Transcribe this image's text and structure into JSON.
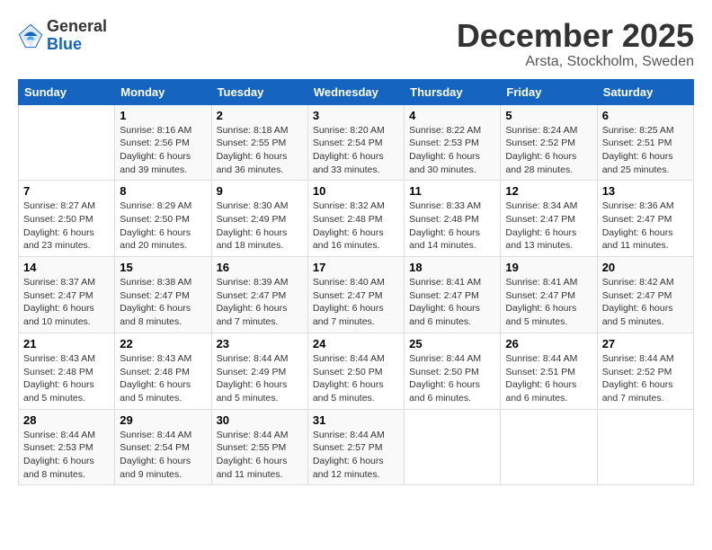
{
  "logo": {
    "general": "General",
    "blue": "Blue"
  },
  "title": "December 2025",
  "subtitle": "Arsta, Stockholm, Sweden",
  "days_header": [
    "Sunday",
    "Monday",
    "Tuesday",
    "Wednesday",
    "Thursday",
    "Friday",
    "Saturday"
  ],
  "weeks": [
    [
      {
        "num": "",
        "info": ""
      },
      {
        "num": "1",
        "info": "Sunrise: 8:16 AM\nSunset: 2:56 PM\nDaylight: 6 hours\nand 39 minutes."
      },
      {
        "num": "2",
        "info": "Sunrise: 8:18 AM\nSunset: 2:55 PM\nDaylight: 6 hours\nand 36 minutes."
      },
      {
        "num": "3",
        "info": "Sunrise: 8:20 AM\nSunset: 2:54 PM\nDaylight: 6 hours\nand 33 minutes."
      },
      {
        "num": "4",
        "info": "Sunrise: 8:22 AM\nSunset: 2:53 PM\nDaylight: 6 hours\nand 30 minutes."
      },
      {
        "num": "5",
        "info": "Sunrise: 8:24 AM\nSunset: 2:52 PM\nDaylight: 6 hours\nand 28 minutes."
      },
      {
        "num": "6",
        "info": "Sunrise: 8:25 AM\nSunset: 2:51 PM\nDaylight: 6 hours\nand 25 minutes."
      }
    ],
    [
      {
        "num": "7",
        "info": "Sunrise: 8:27 AM\nSunset: 2:50 PM\nDaylight: 6 hours\nand 23 minutes."
      },
      {
        "num": "8",
        "info": "Sunrise: 8:29 AM\nSunset: 2:50 PM\nDaylight: 6 hours\nand 20 minutes."
      },
      {
        "num": "9",
        "info": "Sunrise: 8:30 AM\nSunset: 2:49 PM\nDaylight: 6 hours\nand 18 minutes."
      },
      {
        "num": "10",
        "info": "Sunrise: 8:32 AM\nSunset: 2:48 PM\nDaylight: 6 hours\nand 16 minutes."
      },
      {
        "num": "11",
        "info": "Sunrise: 8:33 AM\nSunset: 2:48 PM\nDaylight: 6 hours\nand 14 minutes."
      },
      {
        "num": "12",
        "info": "Sunrise: 8:34 AM\nSunset: 2:47 PM\nDaylight: 6 hours\nand 13 minutes."
      },
      {
        "num": "13",
        "info": "Sunrise: 8:36 AM\nSunset: 2:47 PM\nDaylight: 6 hours\nand 11 minutes."
      }
    ],
    [
      {
        "num": "14",
        "info": "Sunrise: 8:37 AM\nSunset: 2:47 PM\nDaylight: 6 hours\nand 10 minutes."
      },
      {
        "num": "15",
        "info": "Sunrise: 8:38 AM\nSunset: 2:47 PM\nDaylight: 6 hours\nand 8 minutes."
      },
      {
        "num": "16",
        "info": "Sunrise: 8:39 AM\nSunset: 2:47 PM\nDaylight: 6 hours\nand 7 minutes."
      },
      {
        "num": "17",
        "info": "Sunrise: 8:40 AM\nSunset: 2:47 PM\nDaylight: 6 hours\nand 7 minutes."
      },
      {
        "num": "18",
        "info": "Sunrise: 8:41 AM\nSunset: 2:47 PM\nDaylight: 6 hours\nand 6 minutes."
      },
      {
        "num": "19",
        "info": "Sunrise: 8:41 AM\nSunset: 2:47 PM\nDaylight: 6 hours\nand 5 minutes."
      },
      {
        "num": "20",
        "info": "Sunrise: 8:42 AM\nSunset: 2:47 PM\nDaylight: 6 hours\nand 5 minutes."
      }
    ],
    [
      {
        "num": "21",
        "info": "Sunrise: 8:43 AM\nSunset: 2:48 PM\nDaylight: 6 hours\nand 5 minutes."
      },
      {
        "num": "22",
        "info": "Sunrise: 8:43 AM\nSunset: 2:48 PM\nDaylight: 6 hours\nand 5 minutes."
      },
      {
        "num": "23",
        "info": "Sunrise: 8:44 AM\nSunset: 2:49 PM\nDaylight: 6 hours\nand 5 minutes."
      },
      {
        "num": "24",
        "info": "Sunrise: 8:44 AM\nSunset: 2:50 PM\nDaylight: 6 hours\nand 5 minutes."
      },
      {
        "num": "25",
        "info": "Sunrise: 8:44 AM\nSunset: 2:50 PM\nDaylight: 6 hours\nand 6 minutes."
      },
      {
        "num": "26",
        "info": "Sunrise: 8:44 AM\nSunset: 2:51 PM\nDaylight: 6 hours\nand 6 minutes."
      },
      {
        "num": "27",
        "info": "Sunrise: 8:44 AM\nSunset: 2:52 PM\nDaylight: 6 hours\nand 7 minutes."
      }
    ],
    [
      {
        "num": "28",
        "info": "Sunrise: 8:44 AM\nSunset: 2:53 PM\nDaylight: 6 hours\nand 8 minutes."
      },
      {
        "num": "29",
        "info": "Sunrise: 8:44 AM\nSunset: 2:54 PM\nDaylight: 6 hours\nand 9 minutes."
      },
      {
        "num": "30",
        "info": "Sunrise: 8:44 AM\nSunset: 2:55 PM\nDaylight: 6 hours\nand 11 minutes."
      },
      {
        "num": "31",
        "info": "Sunrise: 8:44 AM\nSunset: 2:57 PM\nDaylight: 6 hours\nand 12 minutes."
      },
      {
        "num": "",
        "info": ""
      },
      {
        "num": "",
        "info": ""
      },
      {
        "num": "",
        "info": ""
      }
    ]
  ]
}
